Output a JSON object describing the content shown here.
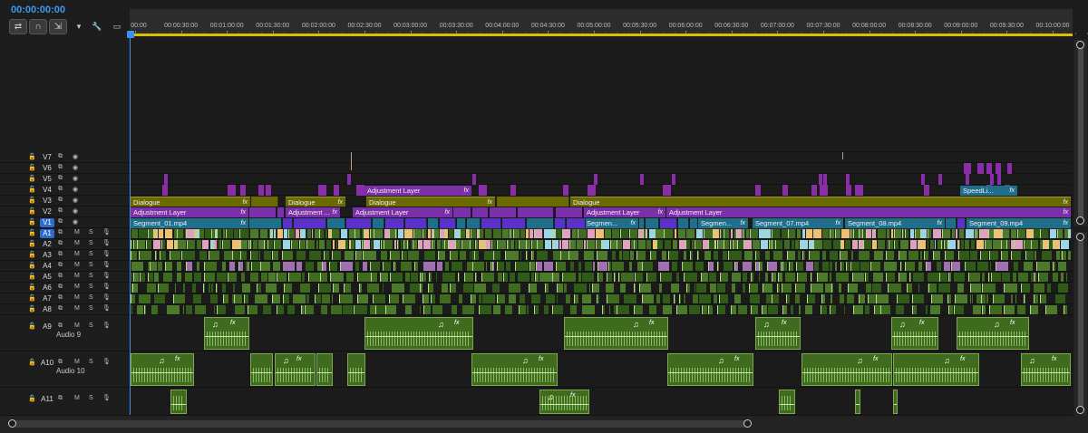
{
  "timecode": "00:00:00:00",
  "toolbar": {
    "items": [
      {
        "name": "insert-overwrite-icon",
        "glyph": "⇄"
      },
      {
        "name": "snap-magnet-icon",
        "glyph": "∩"
      },
      {
        "name": "linked-selection-icon",
        "glyph": "⇲"
      },
      {
        "name": "add-marker-icon",
        "glyph": "▾"
      },
      {
        "name": "timeline-settings-wrench-icon",
        "glyph": "🔧"
      },
      {
        "name": "captions-icon",
        "glyph": "▭"
      }
    ]
  },
  "ruler": {
    "labels": [
      "00:00",
      "00:00:30:00",
      "00:01:00:00",
      "00:01:30:00",
      "00:02:00:00",
      "00:02:30:00",
      "00:03:00:00",
      "00:03:30:00",
      "00:04:00:00",
      "00:04:30:00",
      "00:05:00:00",
      "00:05:30:00",
      "00:06:00:00",
      "00:06:30:00",
      "00:07:00:00",
      "00:07:30:00",
      "00:08:00:00",
      "00:08:30:00",
      "00:09:00:00",
      "00:09:30:00",
      "00:10:00:00"
    ]
  },
  "video_tracks": [
    {
      "id": "V7",
      "label": "V7"
    },
    {
      "id": "V6",
      "label": "V6"
    },
    {
      "id": "V5",
      "label": "V5"
    },
    {
      "id": "V4",
      "label": "V4"
    },
    {
      "id": "V3",
      "label": "V3"
    },
    {
      "id": "V2",
      "label": "V2"
    },
    {
      "id": "V1",
      "label": "V1",
      "active": true
    }
  ],
  "audio_tracks": [
    {
      "id": "A1",
      "label": "A1",
      "active": true,
      "m": "M",
      "s": "S"
    },
    {
      "id": "A2",
      "label": "A2",
      "m": "M",
      "s": "S"
    },
    {
      "id": "A3",
      "label": "A3",
      "m": "M",
      "s": "S"
    },
    {
      "id": "A4",
      "label": "A4",
      "m": "M",
      "s": "S"
    },
    {
      "id": "A5",
      "label": "A5",
      "m": "M",
      "s": "S"
    },
    {
      "id": "A6",
      "label": "A6",
      "m": "M",
      "s": "S"
    },
    {
      "id": "A7",
      "label": "A7",
      "m": "M",
      "s": "S"
    },
    {
      "id": "A8",
      "label": "A8",
      "m": "M",
      "s": "S"
    },
    {
      "id": "A9",
      "label": "A9",
      "m": "M",
      "s": "S",
      "sub": "Audio 9"
    },
    {
      "id": "A10",
      "label": "A10",
      "m": "M",
      "s": "S",
      "sub": "Audio 10"
    },
    {
      "id": "A11",
      "label": "A11",
      "m": "M",
      "s": "S"
    }
  ],
  "clips": {
    "v4": [
      {
        "label": "Adjustment Layer",
        "fx": "fx"
      },
      {
        "label": "SpeedLi...",
        "fx": "fx"
      }
    ],
    "v3": [
      {
        "label": "Dialogue",
        "fx": "fx"
      },
      {
        "label": "Dialogue",
        "fx": "fx"
      },
      {
        "label": "Dialogue",
        "fx": "fx"
      },
      {
        "label": "Dialogue",
        "fx": "fx"
      }
    ],
    "v2": [
      {
        "label": "Adjustment Layer",
        "fx": "fx"
      },
      {
        "label": "Adjustment ...",
        "fx": "fx"
      },
      {
        "label": "Adjustment Layer",
        "fx": "fx"
      },
      {
        "label": "Adjustment Layer",
        "fx": "fx"
      },
      {
        "label": "Adjustment Layer",
        "fx": "fx"
      }
    ],
    "v1": [
      {
        "label": "Segment_01.mp4",
        "fx": "fx"
      },
      {
        "label": "Segmen...",
        "fx": "fx"
      },
      {
        "label": "Segmen...",
        "fx": "fx"
      },
      {
        "label": "Segment_07.mp4",
        "fx": "fx"
      },
      {
        "label": "Segment_08.mp4",
        "fx": "fx"
      },
      {
        "label": "Segment_09.mp4",
        "fx": "fx"
      }
    ]
  },
  "audio_clip_glyphs": {
    "note": "♫",
    "fx": "fx"
  },
  "colors": {
    "accent": "#3d9bf5",
    "playhead": "#3d8ff5",
    "work_area": "#d8c200",
    "dialogue": "#6a6a00",
    "adjustment": "#7b2fa8",
    "video_clip": "#1f6e8c",
    "audio_clip": "#3e6b1e"
  }
}
